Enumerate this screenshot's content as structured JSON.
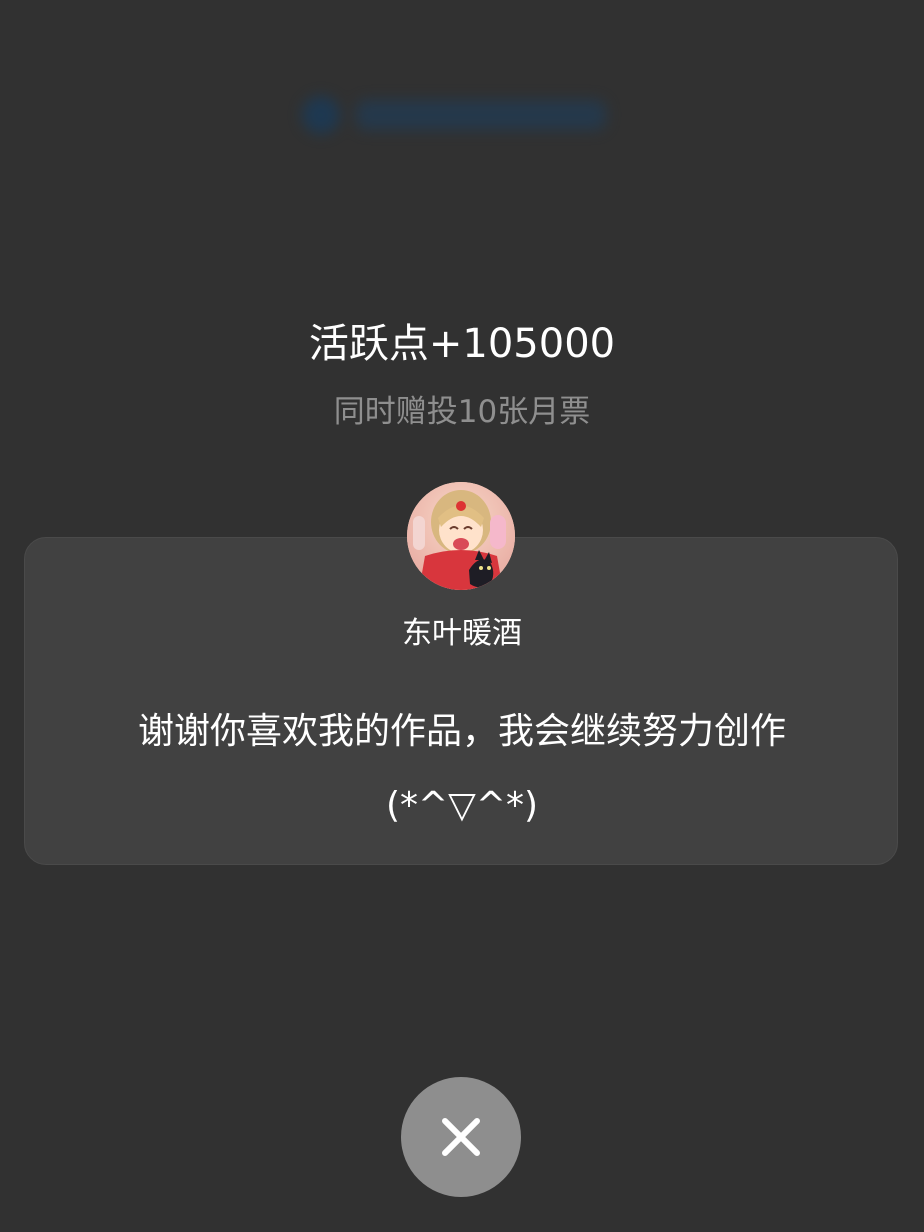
{
  "modal": {
    "activity_title": "活跃点+105000",
    "activity_subtitle": "同时赠投10张月票",
    "author_name": "东叶暖酒",
    "message": "谢谢你喜欢我的作品，我会继续努力创作(*^▽^*)",
    "close_icon": "close-icon",
    "avatar_icon": "author-avatar"
  },
  "colors": {
    "background": "#313131",
    "card": "#414141",
    "subtitle": "#8f8f8f",
    "close_button": "#8e8e8e"
  }
}
